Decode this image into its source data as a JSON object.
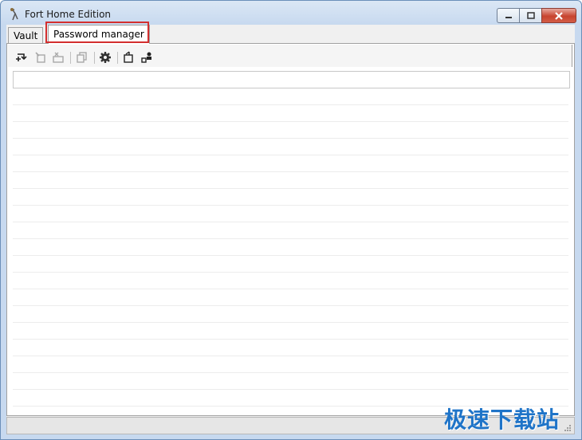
{
  "window": {
    "title": "Fort Home Edition"
  },
  "tabs": [
    {
      "label": "Vault",
      "active": false
    },
    {
      "label": "Password manager",
      "active": true
    }
  ],
  "toolbar": {
    "buttons": [
      {
        "icon": "add-entry-icon",
        "enabled": true
      },
      {
        "icon": "edit-entry-icon",
        "enabled": false
      },
      {
        "icon": "delete-entry-icon",
        "enabled": false
      },
      {
        "icon": "copy-icon",
        "enabled": false
      },
      {
        "icon": "gear-icon",
        "enabled": true
      },
      {
        "icon": "export-icon",
        "enabled": true
      },
      {
        "icon": "user-key-icon",
        "enabled": true
      }
    ]
  },
  "search": {
    "value": "",
    "placeholder": ""
  },
  "entries": [],
  "watermark": "极速下载站",
  "colors": {
    "highlight": "#d32f2f",
    "titlebar": "#c7d9ef",
    "close": "#c7442f",
    "watermark": "#1f74c8"
  }
}
